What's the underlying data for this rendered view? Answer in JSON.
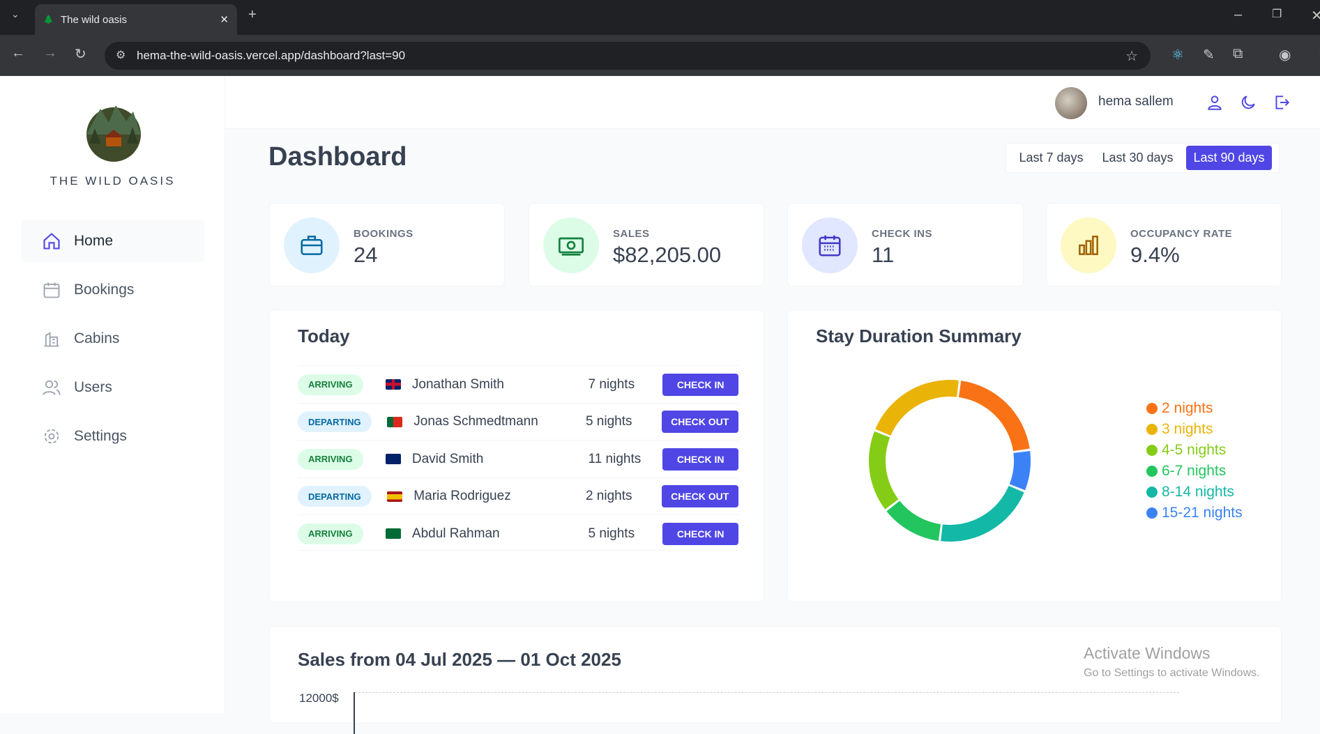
{
  "browser": {
    "tab_title": "The wild oasis",
    "url": "hema-the-wild-oasis.vercel.app/dashboard?last=90"
  },
  "brand": {
    "name": "THE WILD OASIS"
  },
  "sidebar": {
    "items": [
      {
        "label": "Home"
      },
      {
        "label": "Bookings"
      },
      {
        "label": "Cabins"
      },
      {
        "label": "Users"
      },
      {
        "label": "Settings"
      }
    ]
  },
  "header": {
    "user_name": "hema sallem"
  },
  "page": {
    "title": "Dashboard"
  },
  "filter": {
    "options": [
      "Last 7 days",
      "Last 30 days",
      "Last 90 days"
    ],
    "selected": "Last 90 days"
  },
  "stats": [
    {
      "label": "BOOKINGS",
      "value": "24",
      "color": "#e0f2fe",
      "icon": "briefcase-icon"
    },
    {
      "label": "SALES",
      "value": "$82,205.00",
      "color": "#dcfce7",
      "icon": "banknote-icon"
    },
    {
      "label": "CHECK INS",
      "value": "11",
      "color": "#e0e7ff",
      "icon": "calendar-icon"
    },
    {
      "label": "OCCUPANCY RATE",
      "value": "9.4%",
      "color": "#fef9c3",
      "icon": "bar-chart-icon"
    }
  ],
  "today": {
    "title": "Today",
    "rows": [
      {
        "status": "ARRIVING",
        "flag": "uk",
        "guest": "Jonathan Smith",
        "nights": "7 nights",
        "action": "CHECK IN"
      },
      {
        "status": "DEPARTING",
        "flag": "pt",
        "guest": "Jonas Schmedtmann",
        "nights": "5 nights",
        "action": "CHECK OUT"
      },
      {
        "status": "ARRIVING",
        "flag": "au",
        "guest": "David Smith",
        "nights": "11 nights",
        "action": "CHECK IN"
      },
      {
        "status": "DEPARTING",
        "flag": "es",
        "guest": "Maria Rodriguez",
        "nights": "2 nights",
        "action": "CHECK OUT"
      },
      {
        "status": "ARRIVING",
        "flag": "sa",
        "guest": "Abdul Rahman",
        "nights": "5 nights",
        "action": "CHECK IN"
      }
    ]
  },
  "chart_data": [
    {
      "type": "pie",
      "title": "Stay Duration Summary",
      "legend": "right",
      "categories": [
        "2 nights",
        "3 nights",
        "4-5 nights",
        "6-7 nights",
        "8-14 nights",
        "15-21 nights"
      ],
      "values": [
        5,
        5,
        4,
        3,
        5,
        2
      ],
      "colors": [
        "#f97316",
        "#eab308",
        "#84cc16",
        "#22c55e",
        "#14b8a6",
        "#3b82f6"
      ]
    },
    {
      "type": "area",
      "title": "Sales from 04 Jul 2025 — 01 Oct 2025",
      "ytick_top": "12000$"
    }
  ],
  "overlay": {
    "activate_title": "Activate Windows",
    "activate_sub": "Go to Settings to activate Windows."
  }
}
